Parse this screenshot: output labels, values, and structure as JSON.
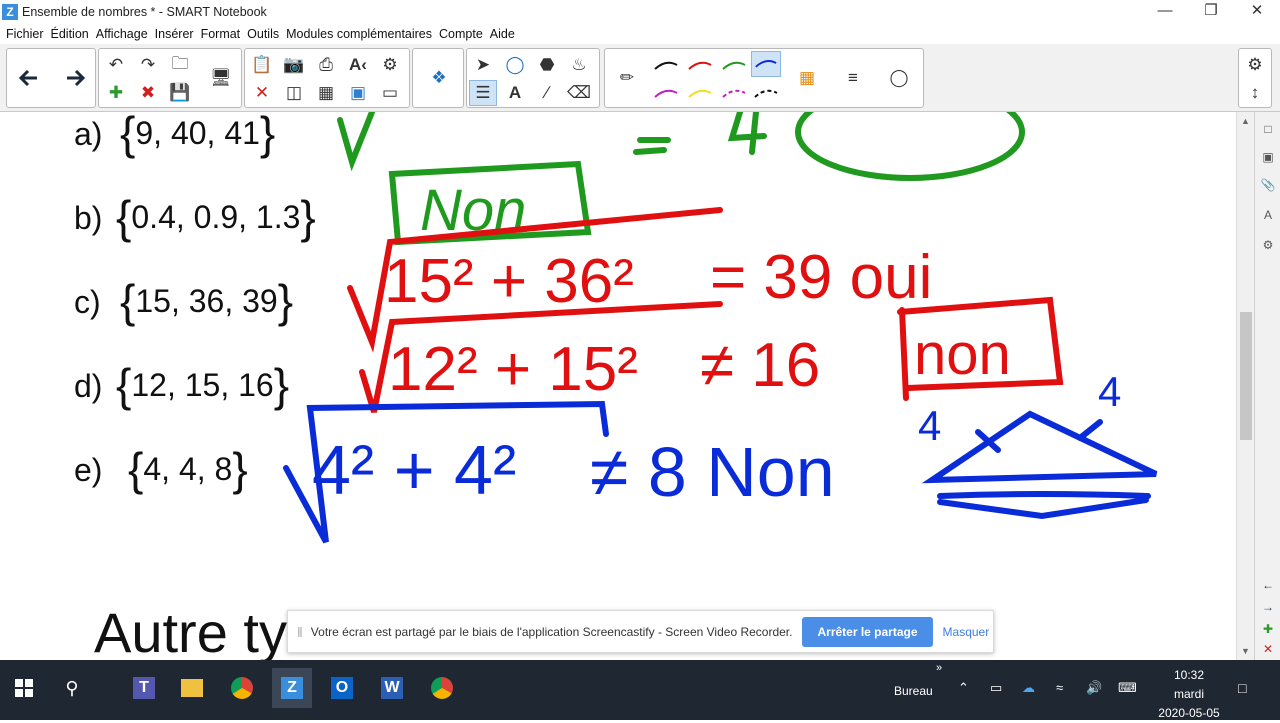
{
  "window": {
    "title": "Ensemble de nombres * - SMART Notebook"
  },
  "menu": [
    "Fichier",
    "Édition",
    "Affichage",
    "Insérer",
    "Format",
    "Outils",
    "Modules complémentaires",
    "Compte",
    "Aide"
  ],
  "questions": [
    {
      "label": "a)",
      "set": "9, 40, 41"
    },
    {
      "label": "b)",
      "set": "0.4, 0.9, 1.3"
    },
    {
      "label": "c)",
      "set": "15, 36, 39"
    },
    {
      "label": "d)",
      "set": "12, 15, 16"
    },
    {
      "label": "e)",
      "set": "4, 4, 8"
    }
  ],
  "page_heading": "Autre ty",
  "handwriting": {
    "green_answer": "Non",
    "red_line_c_left": "15² + 36²",
    "red_line_c_right": "= 39 oui",
    "red_line_d_left": "12² + 15²",
    "red_line_d_right": "≠ 16",
    "red_line_d_box": "non",
    "blue_line_e_left": "4² + 4²",
    "blue_line_e_right": "≠ 8 Non",
    "blue_side_label_1": "4",
    "blue_side_label_2": "4"
  },
  "share_banner": {
    "message": "Votre écran est partagé par le biais de l'application Screencastify - Screen Video Recorder.",
    "stop_button": "Arrêter le partage",
    "hide_link": "Masquer"
  },
  "taskbar": {
    "desktop_label": "Bureau",
    "time": "10:32",
    "day": "mardi",
    "date": "2020-05-05"
  },
  "colors": {
    "ink_green": "#1f9a1f",
    "ink_red": "#e01010",
    "ink_blue": "#0a2bd8",
    "taskbar_bg": "#1f2733",
    "accent_blue": "#4a8ee8"
  }
}
